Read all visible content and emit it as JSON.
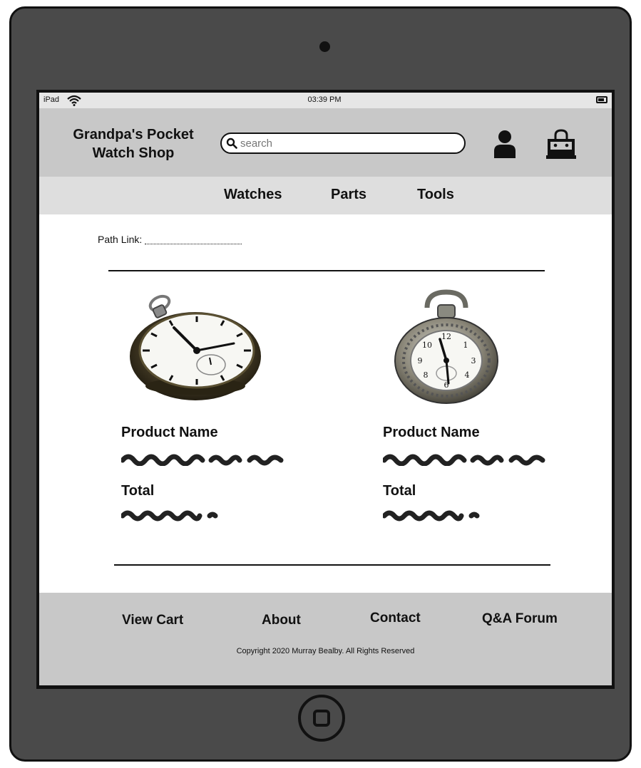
{
  "status_bar": {
    "device": "iPad",
    "time": "03:39 PM"
  },
  "header": {
    "title": "Grandpa's Pocket\nWatch Shop",
    "search": {
      "placeholder": "search",
      "value": ""
    }
  },
  "nav": {
    "items": [
      "Watches",
      "Parts",
      "Tools"
    ]
  },
  "breadcrumb": {
    "label": "Path Link:"
  },
  "products": [
    {
      "name_label": "Product Name",
      "total_label": "Total"
    },
    {
      "name_label": "Product Name",
      "total_label": "Total"
    }
  ],
  "footer": {
    "links": [
      "View Cart",
      "About",
      "Contact",
      "Q&A Forum"
    ],
    "copyright": "Copyright  2020 Murray Bealby. All Rights Reserved"
  },
  "icons": {
    "search": "search-icon",
    "user": "user-icon",
    "cart": "shopping-bag-icon",
    "wifi": "wifi-icon",
    "battery": "battery-icon"
  },
  "colors": {
    "device_frame": "#4a4a4a",
    "header_bg": "#c8c8c8",
    "nav_bg": "#dedede",
    "footer_bg": "#c8c8c8",
    "status_bg": "#e6e6e6"
  }
}
